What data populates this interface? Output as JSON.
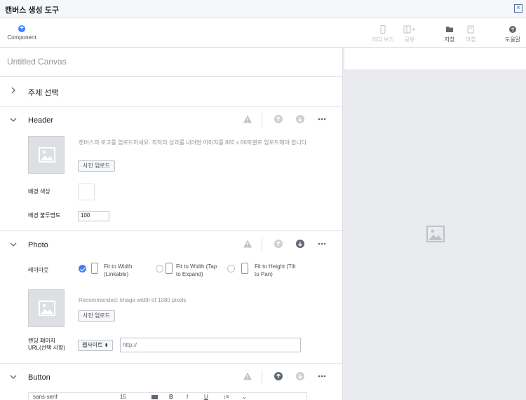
{
  "window": {
    "title": "캔버스 생성 도구",
    "close_icon": "close-icon"
  },
  "toolbar": {
    "component": "Component",
    "preview": "미리 보기",
    "share": "공유",
    "save": "저장",
    "finish": "마침",
    "help": "도움말"
  },
  "canvas": {
    "name": "Untitled Canvas"
  },
  "theme": {
    "label": "주제 선택"
  },
  "header_section": {
    "title": "Header",
    "upload_hint": "캔버스의 로고를 업로드하세요. 최적의 성과를 내려면 이미지를 882 x 66픽셀로 업로드해야 합니다",
    "upload_button": "사진 업로드",
    "bg_color_label": "배경 색상",
    "bg_opacity_label": "배경 불투명도",
    "bg_opacity_value": "100"
  },
  "photo_section": {
    "title": "Photo",
    "layout_label": "레이아웃",
    "layout_options": [
      {
        "label": "Fit to Width (Linkable)",
        "selected": true
      },
      {
        "label": "Fit to Width (Tap to Expand)",
        "selected": false
      },
      {
        "label": "Fit to Height (Tilt to Pan)",
        "selected": false
      }
    ],
    "upload_hint": "Recommended: Image width of 1080 pixels",
    "upload_button": "사진 업로드",
    "landing_label": "랜딩 페이지 URL(선택 사항)",
    "landing_type": "웹사이트",
    "url_placeholder": "http://"
  },
  "button_section": {
    "title": "Button",
    "font": "sans-serif",
    "size": "15"
  },
  "colors": {
    "accent": "#4080ff",
    "border": "#dddfe2",
    "preview_bg": "#e9ebee"
  }
}
